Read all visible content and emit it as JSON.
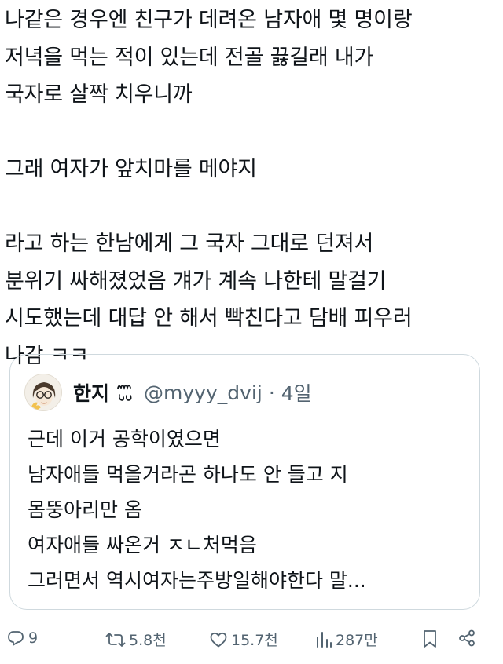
{
  "post": {
    "lines": [
      "나같은 경우엔 친구가 데려온 남자애 몇 명이랑",
      "저녁을 먹는 적이 있는데 전골 끓길래 내가",
      "국자로 살짝 치우니까",
      "",
      "그래 여자가 앞치마를 메야지",
      "",
      "라고 하는 한남에게 그 국자 그대로 던져서",
      "분위기 싸해졌었음 걔가 계속 나한테 말걸기",
      "시도했는데 대답 안 해서 빡친다고 담배 피우러",
      "나감 ㅋㅋ"
    ]
  },
  "quote": {
    "name": "한지",
    "handle": "@myyy_dvij",
    "separator": "·",
    "time": "4일",
    "lines": [
      "근데 이거 공학이였으면",
      "남자애들 먹을거라곤 하나도 안 들고 지",
      "몸뚱아리만 옴",
      "여자애들 싸온거 ㅈㄴ처먹음",
      "그러면서 역시여자는주방일해야한다 말..."
    ]
  },
  "actions": {
    "replies": "9",
    "reposts": "5.8천",
    "likes": "15.7천",
    "views": "287만"
  },
  "icons": {
    "reply": "comment-bubble-icon",
    "repost": "repost-arrows-icon",
    "like": "heart-icon",
    "views": "bar-chart-icon",
    "bookmark": "bookmark-icon",
    "share": "share-icon"
  },
  "colors": {
    "text": "#0f1419",
    "secondary": "#536471",
    "border": "#cfd9de"
  }
}
